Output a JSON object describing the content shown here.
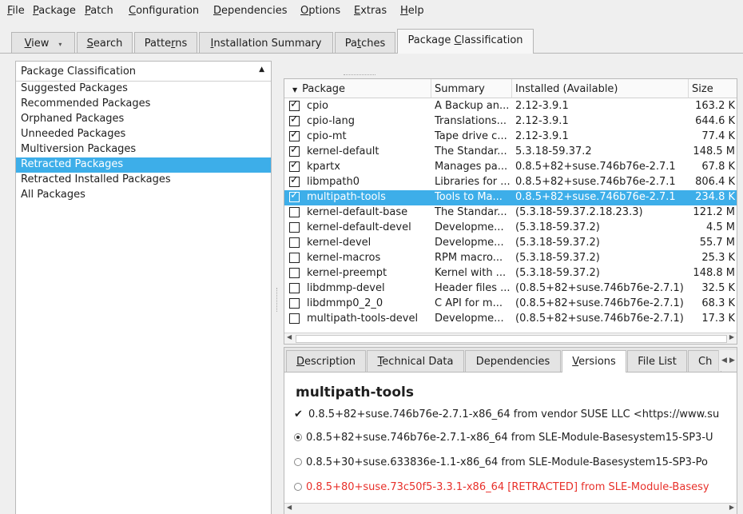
{
  "menubar": {
    "items": [
      {
        "u": "F",
        "rest": "ile"
      },
      {
        "u": "P",
        "rest": "ackage"
      },
      {
        "u": "P",
        "rest": "atch"
      },
      {
        "u": "C",
        "rest": "onfiguration"
      },
      {
        "u": "D",
        "rest": "ependencies"
      },
      {
        "u": "O",
        "rest": "ptions"
      },
      {
        "u": "E",
        "rest": "xtras"
      },
      {
        "u": "H",
        "rest": "elp"
      }
    ]
  },
  "tabs": [
    {
      "pre": "",
      "u": "V",
      "post": "iew"
    },
    {
      "pre": "",
      "u": "S",
      "post": "earch"
    },
    {
      "pre": "Patte",
      "u": "r",
      "post": "ns"
    },
    {
      "pre": "",
      "u": "I",
      "post": "nstallation Summary"
    },
    {
      "pre": "Pa",
      "u": "t",
      "post": "ches"
    },
    {
      "pre": "Package ",
      "u": "C",
      "post": "lassification"
    }
  ],
  "left": {
    "header": "Package Classification",
    "items": [
      "Suggested Packages",
      "Recommended Packages",
      "Orphaned Packages",
      "Unneeded Packages",
      "Multiversion Packages",
      "Retracted Packages",
      "Retracted Installed Packages",
      "All Packages"
    ],
    "selected_index": 5
  },
  "table": {
    "columns": [
      "Package",
      "Summary",
      "Installed (Available)",
      "Size"
    ],
    "rows": [
      {
        "checked": true,
        "name": "cpio",
        "summary": "A Backup an...",
        "version": "2.12-3.9.1",
        "size": "163.2 K"
      },
      {
        "checked": true,
        "name": "cpio-lang",
        "summary": "Translations...",
        "version": "2.12-3.9.1",
        "size": "644.6 K"
      },
      {
        "checked": true,
        "name": "cpio-mt",
        "summary": "Tape drive c...",
        "version": "2.12-3.9.1",
        "size": "77.4 K"
      },
      {
        "checked": true,
        "name": "kernel-default",
        "summary": "The Standar...",
        "version": "5.3.18-59.37.2",
        "size": "148.5 M"
      },
      {
        "checked": true,
        "name": "kpartx",
        "summary": "Manages pa...",
        "version": "0.8.5+82+suse.746b76e-2.7.1",
        "size": "67.8 K"
      },
      {
        "checked": true,
        "name": "libmpath0",
        "summary": "Libraries for ...",
        "version": "0.8.5+82+suse.746b76e-2.7.1",
        "size": "806.4 K"
      },
      {
        "checked": true,
        "name": "multipath-tools",
        "summary": "Tools to Ma...",
        "version": "0.8.5+82+suse.746b76e-2.7.1",
        "size": "234.8 K"
      },
      {
        "checked": false,
        "name": "kernel-default-base",
        "summary": "The Standar...",
        "version": "(5.3.18-59.37.2.18.23.3)",
        "size": "121.2 M"
      },
      {
        "checked": false,
        "name": "kernel-default-devel",
        "summary": "Developme...",
        "version": "(5.3.18-59.37.2)",
        "size": "4.5 M"
      },
      {
        "checked": false,
        "name": "kernel-devel",
        "summary": "Developme...",
        "version": "(5.3.18-59.37.2)",
        "size": "55.7 M"
      },
      {
        "checked": false,
        "name": "kernel-macros",
        "summary": "RPM macro...",
        "version": "(5.3.18-59.37.2)",
        "size": "25.3 K"
      },
      {
        "checked": false,
        "name": "kernel-preempt",
        "summary": "Kernel with ...",
        "version": "(5.3.18-59.37.2)",
        "size": "148.8 M"
      },
      {
        "checked": false,
        "name": "libdmmp-devel",
        "summary": "Header files ...",
        "version": "(0.8.5+82+suse.746b76e-2.7.1)",
        "size": "32.5 K"
      },
      {
        "checked": false,
        "name": "libdmmp0_2_0",
        "summary": "C API for m...",
        "version": "(0.8.5+82+suse.746b76e-2.7.1)",
        "size": "68.3 K"
      },
      {
        "checked": false,
        "name": "multipath-tools-devel",
        "summary": "Developme...",
        "version": "(0.8.5+82+suse.746b76e-2.7.1)",
        "size": "17.3 K"
      }
    ],
    "selected_index": 6
  },
  "detail": {
    "tabs": [
      {
        "pre": "",
        "u": "D",
        "post": "escription"
      },
      {
        "pre": "",
        "u": "T",
        "post": "echnical Data"
      },
      {
        "pre": "Dependencies",
        "u": "",
        "post": ""
      },
      {
        "pre": "",
        "u": "V",
        "post": "ersions"
      },
      {
        "pre": "File List",
        "u": "",
        "post": ""
      },
      {
        "pre": "Ch",
        "u": "",
        "post": ""
      }
    ],
    "active_tab": 3,
    "package_name": "multipath-tools",
    "versions": [
      {
        "marker": "check",
        "text": "0.8.5+82+suse.746b76e-2.7.1-x86_64 from vendor SUSE LLC <https://www.su",
        "retracted": false
      },
      {
        "marker": "radio-selected",
        "text": "0.8.5+82+suse.746b76e-2.7.1-x86_64 from SLE-Module-Basesystem15-SP3-U",
        "retracted": false
      },
      {
        "marker": "radio",
        "text": "0.8.5+30+suse.633836e-1.1-x86_64 from SLE-Module-Basesystem15-SP3-Po",
        "retracted": false
      },
      {
        "marker": "radio",
        "text": "0.8.5+80+suse.73c50f5-3.3.1-x86_64 [RETRACTED] from SLE-Module-Basesy",
        "retracted": true
      }
    ]
  },
  "colors": {
    "selection": "#3daee9",
    "retracted": "#e8302a"
  }
}
